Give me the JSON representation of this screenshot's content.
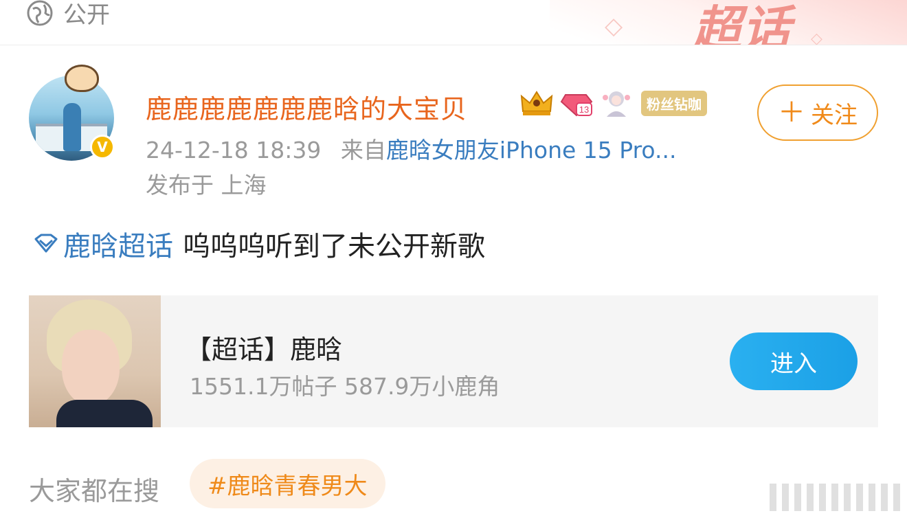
{
  "header": {
    "visibility_label": "公开",
    "supertopic_mark": "超话"
  },
  "post": {
    "author": {
      "name": "鹿鹿鹿鹿鹿鹿鹿晗的大宝贝",
      "fan_tag": "粉丝钻咖",
      "verified": "V"
    },
    "meta": {
      "time": "24-12-18 18:39",
      "from_prefix": "来自",
      "source": "鹿晗女朋友iPhone 15 Pro...",
      "location": "发布于 上海"
    },
    "follow_label": "关注",
    "follow_plus": "＋",
    "topic": "鹿晗超话",
    "text": "呜呜呜听到了未公开新歌"
  },
  "card": {
    "title": "【超话】鹿晗",
    "stats": "1551.1万帖子 587.9万小鹿角",
    "enter_label": "进入"
  },
  "search": {
    "label": "大家都在搜",
    "hot_tag": "#鹿晗青春男大"
  },
  "colors": {
    "username": "#e8651d",
    "link": "#3a7dbf",
    "follow": "#f08a1a",
    "enter": "#1ba0e6",
    "hot_tag": "#ef8a1a"
  }
}
